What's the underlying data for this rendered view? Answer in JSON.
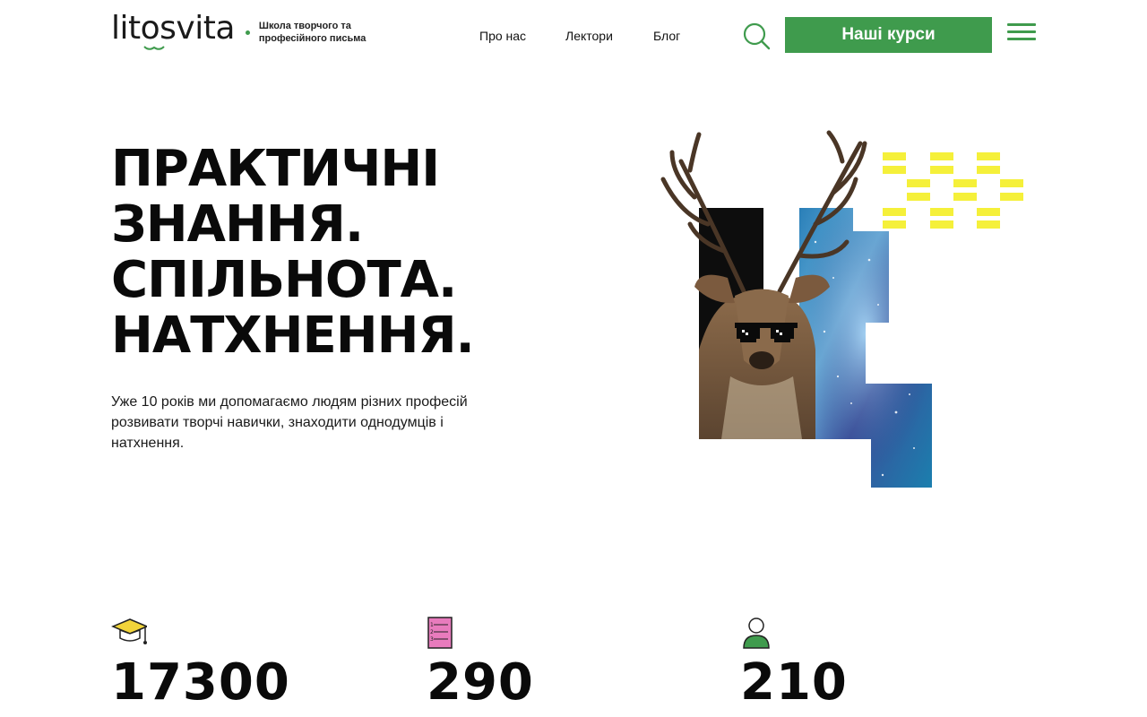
{
  "header": {
    "logo_text": "litosvita",
    "tagline_line1": "Школа творчого та",
    "tagline_line2": "професійного письма",
    "nav": [
      {
        "label": "Про нас"
      },
      {
        "label": "Лектори"
      },
      {
        "label": "Блог"
      }
    ],
    "courses_button": "Наші курси",
    "icons": {
      "search": "search-icon",
      "menu": "hamburger-menu-icon"
    }
  },
  "hero": {
    "title_lines": [
      "ПРАКТИЧНІ",
      "ЗНАННЯ.",
      "СПІЛЬНОТА.",
      "НАТХНЕННЯ."
    ],
    "description": "Уже 10 років ми допомагаємо людям різних професій розвивати творчі навички, знаходити однодумців і натхнення."
  },
  "stats": [
    {
      "icon": "graduation-cap-icon",
      "value": "17300"
    },
    {
      "icon": "notebook-icon",
      "value": "290"
    },
    {
      "icon": "person-icon",
      "value": "210"
    }
  ],
  "colors": {
    "accent": "#3f9b4d",
    "text": "#111111",
    "yellow": "#f5f03a"
  }
}
